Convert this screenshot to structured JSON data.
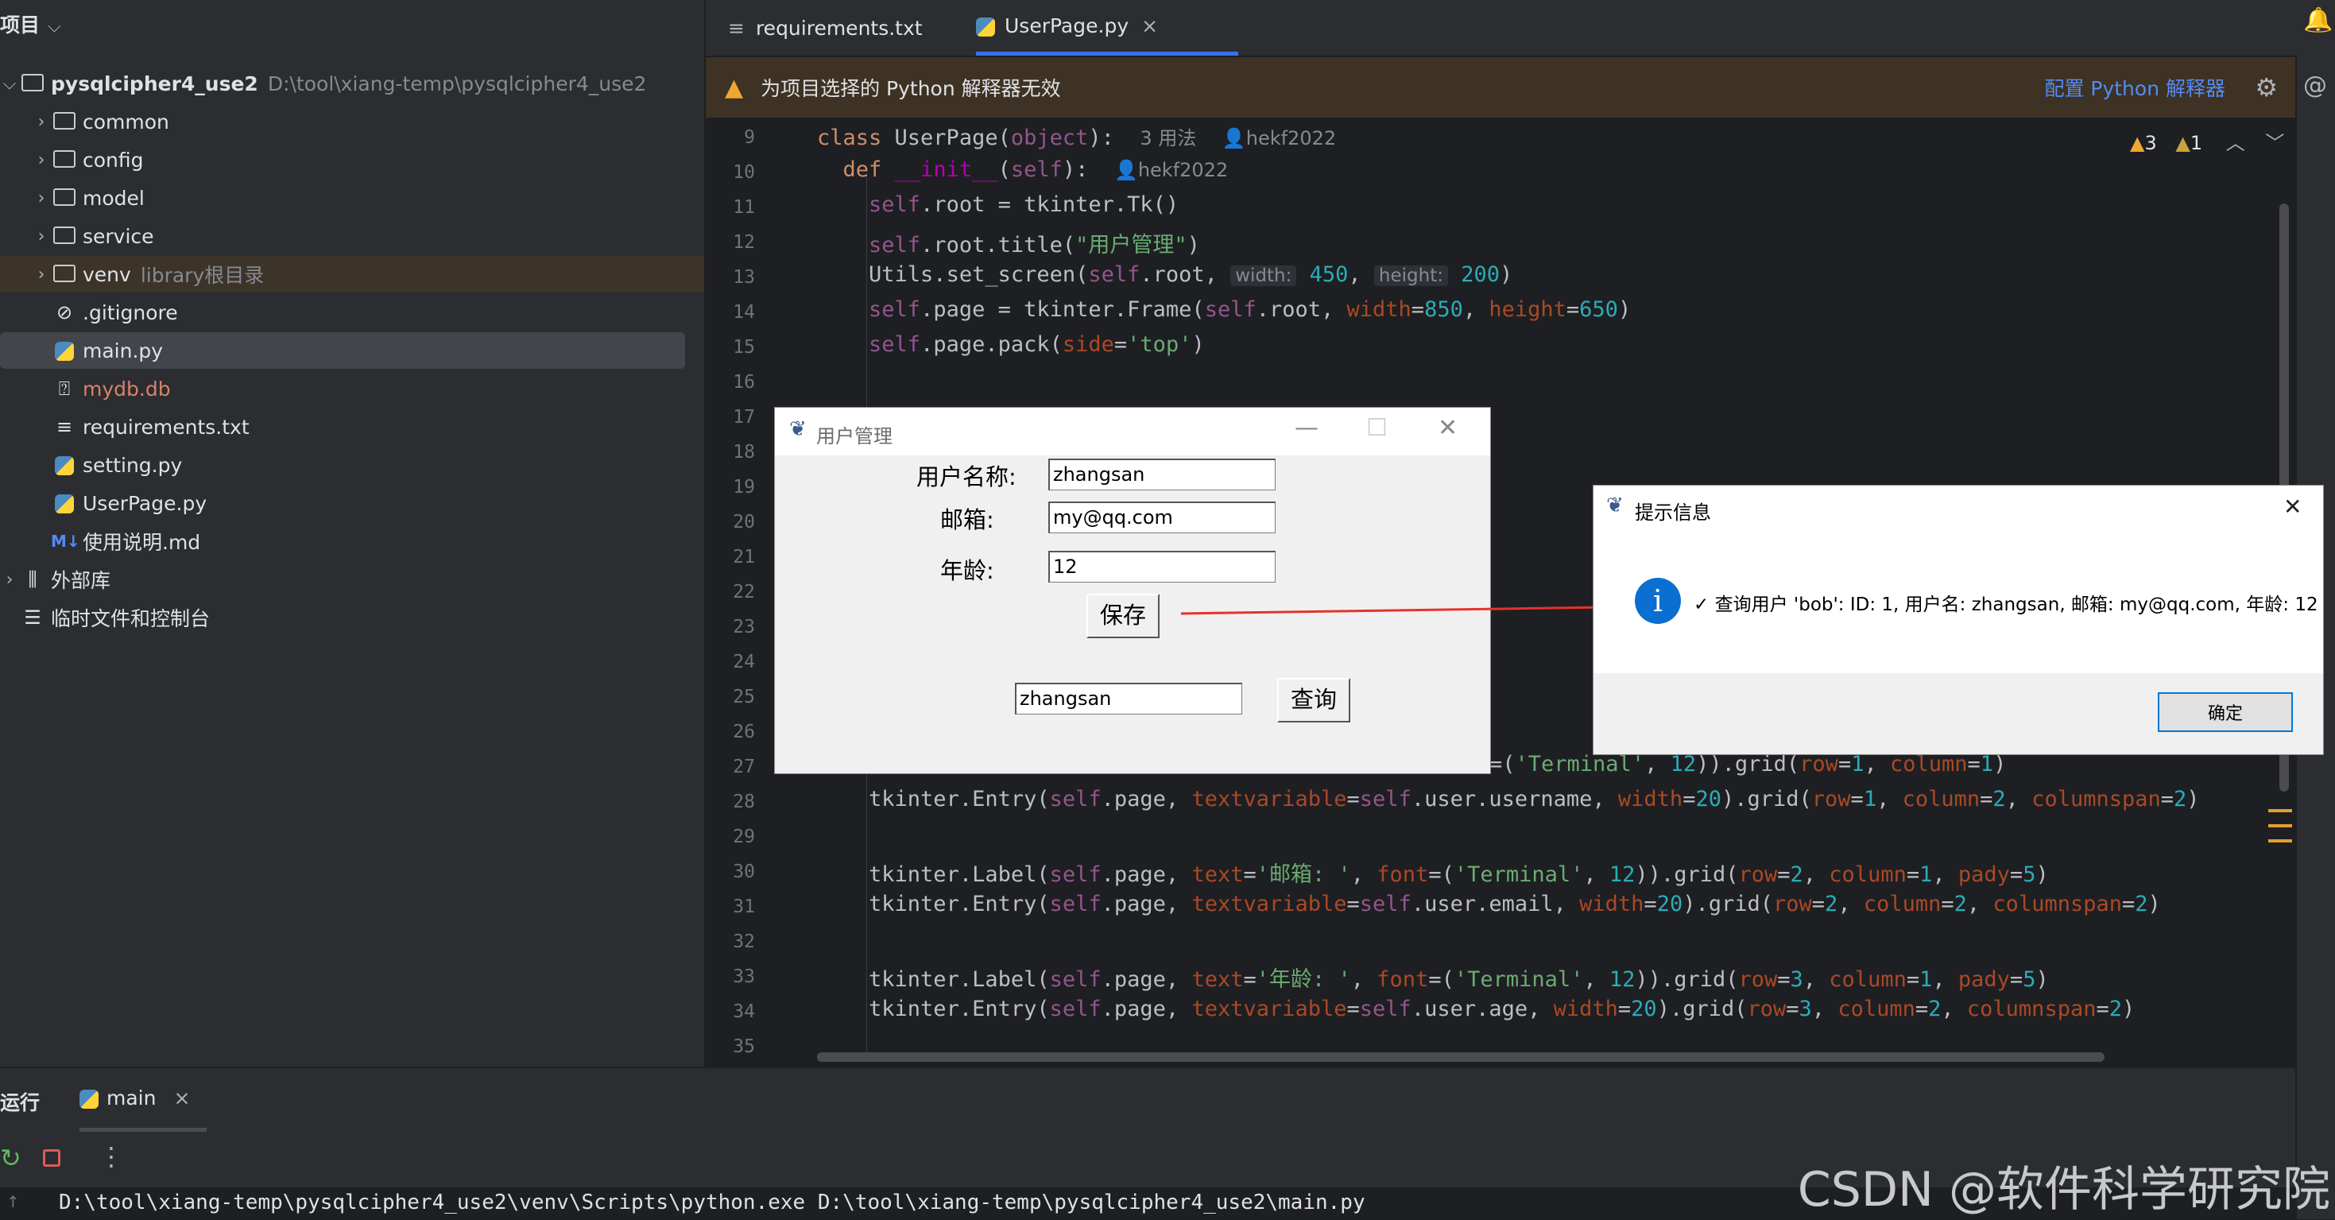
{
  "project_panel": {
    "title": "项目",
    "root_name": "pysqlcipher4_use2",
    "root_path": "D:\\tool\\xiang-temp\\pysqlcipher4_use2",
    "items": [
      {
        "label": "common",
        "hint": ""
      },
      {
        "label": "config",
        "hint": ""
      },
      {
        "label": "model",
        "hint": ""
      },
      {
        "label": "service",
        "hint": ""
      },
      {
        "label": "venv",
        "hint": "library根目录"
      },
      {
        "label": ".gitignore",
        "hint": ""
      },
      {
        "label": "main.py",
        "hint": ""
      },
      {
        "label": "mydb.db",
        "hint": ""
      },
      {
        "label": "requirements.txt",
        "hint": ""
      },
      {
        "label": "setting.py",
        "hint": ""
      },
      {
        "label": "UserPage.py",
        "hint": ""
      },
      {
        "label": "使用说明.md",
        "hint": ""
      },
      {
        "label": "外部库",
        "hint": ""
      },
      {
        "label": "临时文件和控制台",
        "hint": ""
      }
    ],
    "md_badge": "M↓",
    "colors": {
      "venv_row": "#3c3429",
      "selected_row": "#43454a",
      "db_file": "#d9816a"
    }
  },
  "editor": {
    "tabs": [
      {
        "label": "requirements.txt"
      },
      {
        "label": "UserPage.py",
        "close": "×"
      }
    ],
    "warning_text": "为项目选择的 Python 解释器无效",
    "warning_link": "配置 Python 解释器",
    "inspections": {
      "warnings": "3",
      "weak_warnings": "1"
    },
    "line_numbers": [
      "9",
      "10",
      "11",
      "12",
      "13",
      "14",
      "15",
      "16",
      "17",
      "18",
      "19",
      "20",
      "21",
      "22",
      "23",
      "24",
      "25",
      "26",
      "27",
      "28",
      "29",
      "30",
      "31",
      "32",
      "33",
      "34",
      "35"
    ],
    "code": {
      "l9": {
        "kw": "class",
        "name": " UserPage(",
        "base": "object",
        "rest": "):",
        "usages": "3 用法",
        "author": "hekf2022"
      },
      "l10": {
        "kw": "def",
        "name": "__init__",
        "open": "(",
        "self": "self",
        "rest": "):",
        "author": "hekf2022"
      },
      "l11": {
        "self": "self",
        "rest": ".root = tkinter.Tk()"
      },
      "l12": {
        "self": "self",
        "a": ".root.title(",
        "str": "\"用户管理\"",
        "b": ")"
      },
      "l13": {
        "a": "Utils.set_screen(",
        "self": "self",
        "b": ".root, ",
        "hint_w": "width:",
        "w": "450",
        "c": ", ",
        "hint_h": "height:",
        "h": "200",
        "d": ")"
      },
      "l14": {
        "self": "self",
        "a": ".page = tkinter.Frame(",
        "self2": "self",
        "b": ".root, ",
        "p1": "width",
        "e1": "=",
        "n1": "850",
        "c": ", ",
        "p2": "height",
        "e2": "=",
        "n2": "650",
        "d": ")"
      },
      "l15": {
        "self": "self",
        "a": ".page.pack(",
        "p": "side",
        "e": "=",
        "str": "'top'",
        "b": ")"
      },
      "l27": {
        "a": "=(",
        "str": "'Terminal'",
        "b": ", ",
        "n": "12",
        "c": ")).grid(",
        "p1": "row",
        "v1": "1",
        "p2": "column",
        "v2": "1",
        "d": ")"
      },
      "l28": {
        "a": "tkinter.Entry(",
        "self": "self",
        "b": ".page, ",
        "p1": "textvariable",
        "self2": "self",
        "c": ".user.username, ",
        "p2": "width",
        "n": "20",
        "d": ").grid(",
        "p3": "row",
        "v3": "1",
        "p4": "column",
        "v4": "2",
        "p5": "columnspan",
        "v5": "2",
        "e": ")"
      },
      "l30": {
        "a": "tkinter.Label(",
        "self": "self",
        "b": ".page, ",
        "p1": "text",
        "str": "'邮箱: '",
        "p2": "font",
        "str2": "'Terminal'",
        "n": "12",
        "c": ")).grid(",
        "p3": "row",
        "v3": "2",
        "p4": "column",
        "v4": "1",
        "p5": "pady",
        "v5": "5",
        "d": ")"
      },
      "l31": {
        "a": "tkinter.Entry(",
        "self": "self",
        "b": ".page, ",
        "p1": "textvariable",
        "self2": "self",
        "c": ".user.email, ",
        "p2": "width",
        "n": "20",
        "d": ").grid(",
        "p3": "row",
        "v3": "2",
        "p4": "column",
        "v4": "2",
        "p5": "columnspan",
        "v5": "2",
        "e": ")"
      },
      "l33": {
        "a": "tkinter.Label(",
        "self": "self",
        "b": ".page, ",
        "p1": "text",
        "str": "'年龄: '",
        "p2": "font",
        "str2": "'Terminal'",
        "n": "12",
        "c": ")).grid(",
        "p3": "row",
        "v3": "3",
        "p4": "column",
        "v4": "1",
        "p5": "pady",
        "v5": "5",
        "d": ")"
      },
      "l34": {
        "a": "tkinter.Entry(",
        "self": "self",
        "b": ".page, ",
        "p1": "textvariable",
        "self2": "self",
        "c": ".user.age, ",
        "p2": "width",
        "n": "20",
        "d": ").grid(",
        "p3": "row",
        "v3": "3",
        "p4": "column",
        "v4": "2",
        "p5": "columnspan",
        "v5": "2",
        "e": ")"
      }
    },
    "colors": {
      "keyword": "#cf8e6d",
      "self": "#94558d",
      "string": "#6aab73",
      "number": "#2aacb8",
      "param": "#aa4926",
      "function": "#56a8f5"
    }
  },
  "tk_window": {
    "title": "用户管理",
    "label_username": "用户名称:",
    "value_username": "zhangsan",
    "label_email": "邮箱:",
    "value_email": "my@qq.com",
    "label_age": "年龄:",
    "value_age": "12",
    "save_label": "保存",
    "query_value": "zhangsan",
    "query_label": "查询"
  },
  "message_box": {
    "title": "提示信息",
    "info_glyph": "i",
    "message": "✓ 查询用户 'bob': ID: 1, 用户名: zhangsan, 邮箱: my@qq.com, 年龄: 12",
    "ok_label": "确定",
    "close": "✕"
  },
  "run_panel": {
    "title": "运行",
    "tab_label": "main",
    "tab_close": "×",
    "console_line": "D:\\tool\\xiang-temp\\pysqlcipher4_use2\\venv\\Scripts\\python.exe D:\\tool\\xiang-temp\\pysqlcipher4_use2\\main.py"
  },
  "watermark": "CSDN @软件科学研究院",
  "accent_color": "#3574f0",
  "link_color": "#548af7",
  "arrow_color": "#e5322d"
}
